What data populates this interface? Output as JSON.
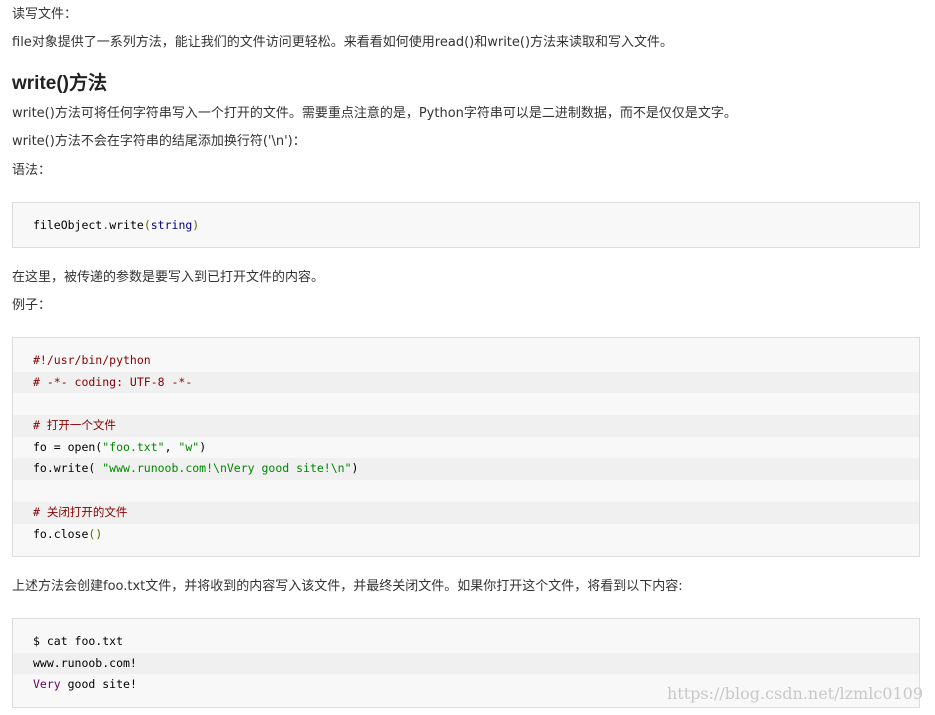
{
  "intro": {
    "heading": "读写文件：",
    "text": "file对象提供了一系列方法，能让我们的文件访问更轻松。来看看如何使用read()和write()方法来读取和写入文件。"
  },
  "section": {
    "title": "write()方法",
    "para1": "write()方法可将任何字符串写入一个打开的文件。需要重点注意的是，Python字符串可以是二进制数据，而不是仅仅是文字。",
    "para2": "write()方法不会在字符串的结尾添加换行符('\\n')：",
    "syntax_label": "语法：",
    "syntax_code": {
      "obj": "fileObject",
      "dot": ".",
      "fn": "write",
      "lp": "(",
      "arg": "string",
      "rp": ")"
    },
    "param_desc": "在这里，被传递的参数是要写入到已打开文件的内容。",
    "example_label": "例子：",
    "example_code": {
      "l1": "#!/usr/bin/python",
      "l2": "# -*- coding: UTF-8 -*-",
      "l4": "# 打开一个文件",
      "l5a": "fo = open(",
      "l5b": "\"foo.txt\"",
      "l5c": ", ",
      "l5d": "\"w\"",
      "l5e": ")",
      "l6a": "fo.write( ",
      "l6b": "\"www.runoob.com!\\nVery good site!\\n\"",
      "l6c": ")",
      "l8": "# 关闭打开的文件",
      "l9a": "fo.close",
      "l9b": "()"
    },
    "result_desc": "上述方法会创建foo.txt文件，并将收到的内容写入该文件，并最终关闭文件。如果你打开这个文件，将看到以下内容:",
    "output_code": {
      "l1": "$ cat foo.txt",
      "l2": "www.runoob.com!",
      "l3a": "Very",
      "l3b": " good site!"
    }
  },
  "watermark": "https://blog.csdn.net/lzmlc0109",
  "colors": {
    "comment": "#880000",
    "string": "#008800",
    "code_bg": "#f8f8f8"
  }
}
